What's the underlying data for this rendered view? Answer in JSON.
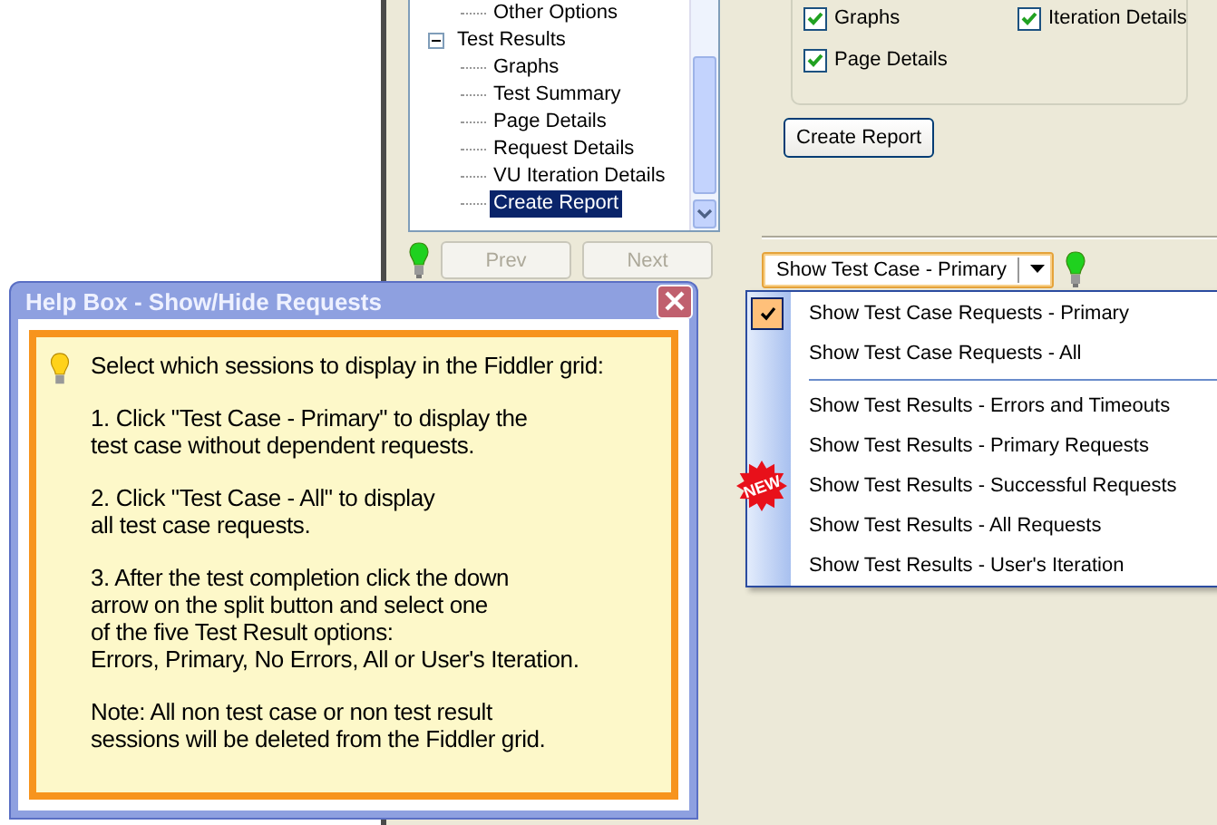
{
  "tree": {
    "items": [
      {
        "label": "Other Options",
        "kind": "leaf",
        "selected": false
      },
      {
        "label": "Test Results",
        "kind": "folder",
        "expanded": true,
        "selected": false,
        "children": [
          {
            "label": "Graphs",
            "kind": "leaf",
            "selected": false
          },
          {
            "label": "Test Summary",
            "kind": "leaf",
            "selected": false
          },
          {
            "label": "Page Details",
            "kind": "leaf",
            "selected": false
          },
          {
            "label": "Request Details",
            "kind": "leaf",
            "selected": false
          },
          {
            "label": "VU Iteration Details",
            "kind": "leaf",
            "selected": false
          },
          {
            "label": "Create Report",
            "kind": "leaf",
            "selected": true
          }
        ]
      }
    ]
  },
  "nav_buttons": [
    {
      "label": "Prev",
      "disabled": true
    },
    {
      "label": "Next",
      "disabled": true
    }
  ],
  "report_options": [
    {
      "label": "Graphs",
      "checked": true
    },
    {
      "label": "Iteration Details",
      "checked": true
    },
    {
      "label": "Page Details",
      "checked": true
    }
  ],
  "create_report_button": "Create Report",
  "split_button": {
    "label": "Show Test Case - Primary"
  },
  "dropdown_menu": [
    {
      "kind": "item",
      "label": "Show Test Case Requests - Primary",
      "selected": true
    },
    {
      "kind": "item",
      "label": "Show Test Case Requests - All",
      "selected": false
    },
    {
      "kind": "separator"
    },
    {
      "kind": "item",
      "label": "Show Test Results - Errors and Timeouts",
      "selected": false
    },
    {
      "kind": "item",
      "label": "Show Test Results - Primary Requests",
      "selected": false
    },
    {
      "kind": "item",
      "label": "Show Test Results - Successful Requests",
      "selected": false,
      "badge": "NEW"
    },
    {
      "kind": "item",
      "label": "Show Test Results - All Requests",
      "selected": false
    },
    {
      "kind": "item",
      "label": "Show Test Results - User's Iteration",
      "selected": false
    }
  ],
  "help_box": {
    "title": "Help Box - Show/Hide Requests",
    "paragraphs": [
      "Select which sessions to display in the Fiddler grid:",
      "1. Click \"Test Case - Primary\" to display the\ntest case without dependent requests.",
      "2. Click \"Test Case - All\" to display\nall test case requests.",
      "3. After the test completion click the down\narrow on the split button and select one\nof the five Test Result options:\nErrors, Primary, No Errors, All or User's Iteration.",
      "Note: All non test case or non test result\nsessions will be deleted from the Fiddler grid."
    ]
  }
}
